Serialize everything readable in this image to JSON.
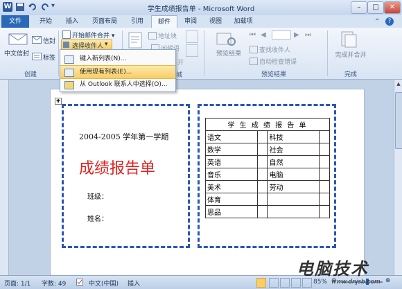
{
  "window": {
    "title": "学生成绩报告单 - Microsoft Word"
  },
  "tabs": [
    "文件",
    "开始",
    "插入",
    "页面布局",
    "引用",
    "邮件",
    "审阅",
    "视图",
    "加载项"
  ],
  "ribbon": {
    "create": {
      "group": "创建",
      "chinese_envelope": "中文信封",
      "envelope": "信封",
      "labels": "标签"
    },
    "start": {
      "start_merge": "开始邮件合并",
      "select_recipients": "选择收件人"
    },
    "write": {
      "address_block": "地址块",
      "greeting": "问候语",
      "hidden": "开",
      "group_tail": "城"
    },
    "preview": {
      "preview_results": "预览结果",
      "find_recipient": "查找收件人",
      "auto_check": "自动检查错误",
      "group": "预览结果"
    },
    "finish": {
      "finish_merge": "完成并合并",
      "group": "完成"
    }
  },
  "dropdown": {
    "items": [
      "键入新列表(N)...",
      "使用现有列表(E)...",
      "从 Outlook 联系人中选择(O)..."
    ]
  },
  "document": {
    "left": {
      "semester": "2004-2005 学年第一学期",
      "title": "成绩报告单",
      "class_label": "班级：",
      "name_label": "姓名："
    },
    "right": {
      "header": "学 生 成 绩 报 告 单",
      "rows": [
        [
          "语文",
          "科技"
        ],
        [
          "数学",
          "社会"
        ],
        [
          "英语",
          "自然"
        ],
        [
          "音乐",
          "电脑"
        ],
        [
          "美术",
          "劳动"
        ],
        [
          "体育",
          ""
        ],
        [
          "思品",
          ""
        ]
      ]
    }
  },
  "status": {
    "page": "页面: 1/1",
    "words": "字数: 49",
    "language": "中文(中国)",
    "insert": "插入",
    "zoom": "85%"
  },
  "watermark": {
    "text": "电脑技术",
    "url": "www.dnjsb.com"
  },
  "colors": {
    "accent": "#2b55b8",
    "title_red": "#e0221e",
    "tab_active": "#2a69b8"
  }
}
